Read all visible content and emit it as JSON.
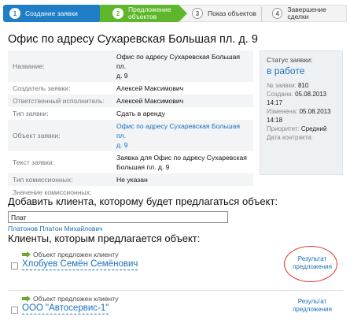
{
  "wizard": {
    "steps": [
      {
        "num": "1",
        "label": "Создание заявки"
      },
      {
        "num": "2",
        "label_line1": "Предложение",
        "label_line2": "объектов"
      },
      {
        "num": "3",
        "label": "Показ объектов"
      },
      {
        "num": "4",
        "label": "Завершение сделки"
      }
    ]
  },
  "page_title": "Офис по адресу Сухаревская Большая пл. д. 9",
  "details": [
    {
      "key": "Название:",
      "value_line1": "Офис по адресу Сухаревская Большая пл.",
      "value_line2": "д. 9"
    },
    {
      "key": "Создатель заявки:",
      "value": "Алексей Максимович"
    },
    {
      "key": "Ответственный исполнитель:",
      "value": "Алексей Максимович"
    },
    {
      "key": "Тип заявки:",
      "value": "Сдать в аренду"
    },
    {
      "key": "Объект заявки:",
      "value_line1": "Офис по адресу Сухаревская Большая пл.",
      "value_line2": "д. 9"
    },
    {
      "key": "Текст заявки:",
      "value_line1": "Заявка для Офис по адресу Сухаревская",
      "value_line2": "Большая пл. д. 9"
    },
    {
      "key": "Тип комиссионных:",
      "value": "Не указан"
    },
    {
      "key": "Значение комиссионных:",
      "value": ""
    }
  ],
  "status": {
    "label": "Статус заявки:",
    "state": "в работе",
    "number_label": "№ заявки:",
    "number": "810",
    "created_label": "Создана:",
    "created_date": "05.08.2013",
    "created_time": "14:17",
    "modified_label": "Изменена:",
    "modified_date": "05.08.2013",
    "modified_time": "14:18",
    "priority_label": "Приоритет:",
    "priority": "Средний",
    "contract_label": "Дата контракта:"
  },
  "add_client": {
    "title": "Добавить клиента, которому будет предлагаться объект:",
    "input_value": "Плат",
    "suggestion": "Платонов Платон Михайлович"
  },
  "clients_title": "Клиенты, которым предлагается объект:",
  "clients": [
    {
      "offered": "Объект предложен клиенту",
      "name": "Хлобуев Семён Семёнович",
      "result_line1": "Результат",
      "result_line2": "предложения"
    },
    {
      "offered": "Объект предложен клиенту",
      "name": "ООО \"Автосервис-1\"",
      "result_line1": "Результат",
      "result_line2": "предложения"
    }
  ],
  "colors": {
    "step_active": "#1f7ec6",
    "step_current": "#5eb62b",
    "link": "#1b6fb8",
    "highlight_oval": "#e03030"
  }
}
